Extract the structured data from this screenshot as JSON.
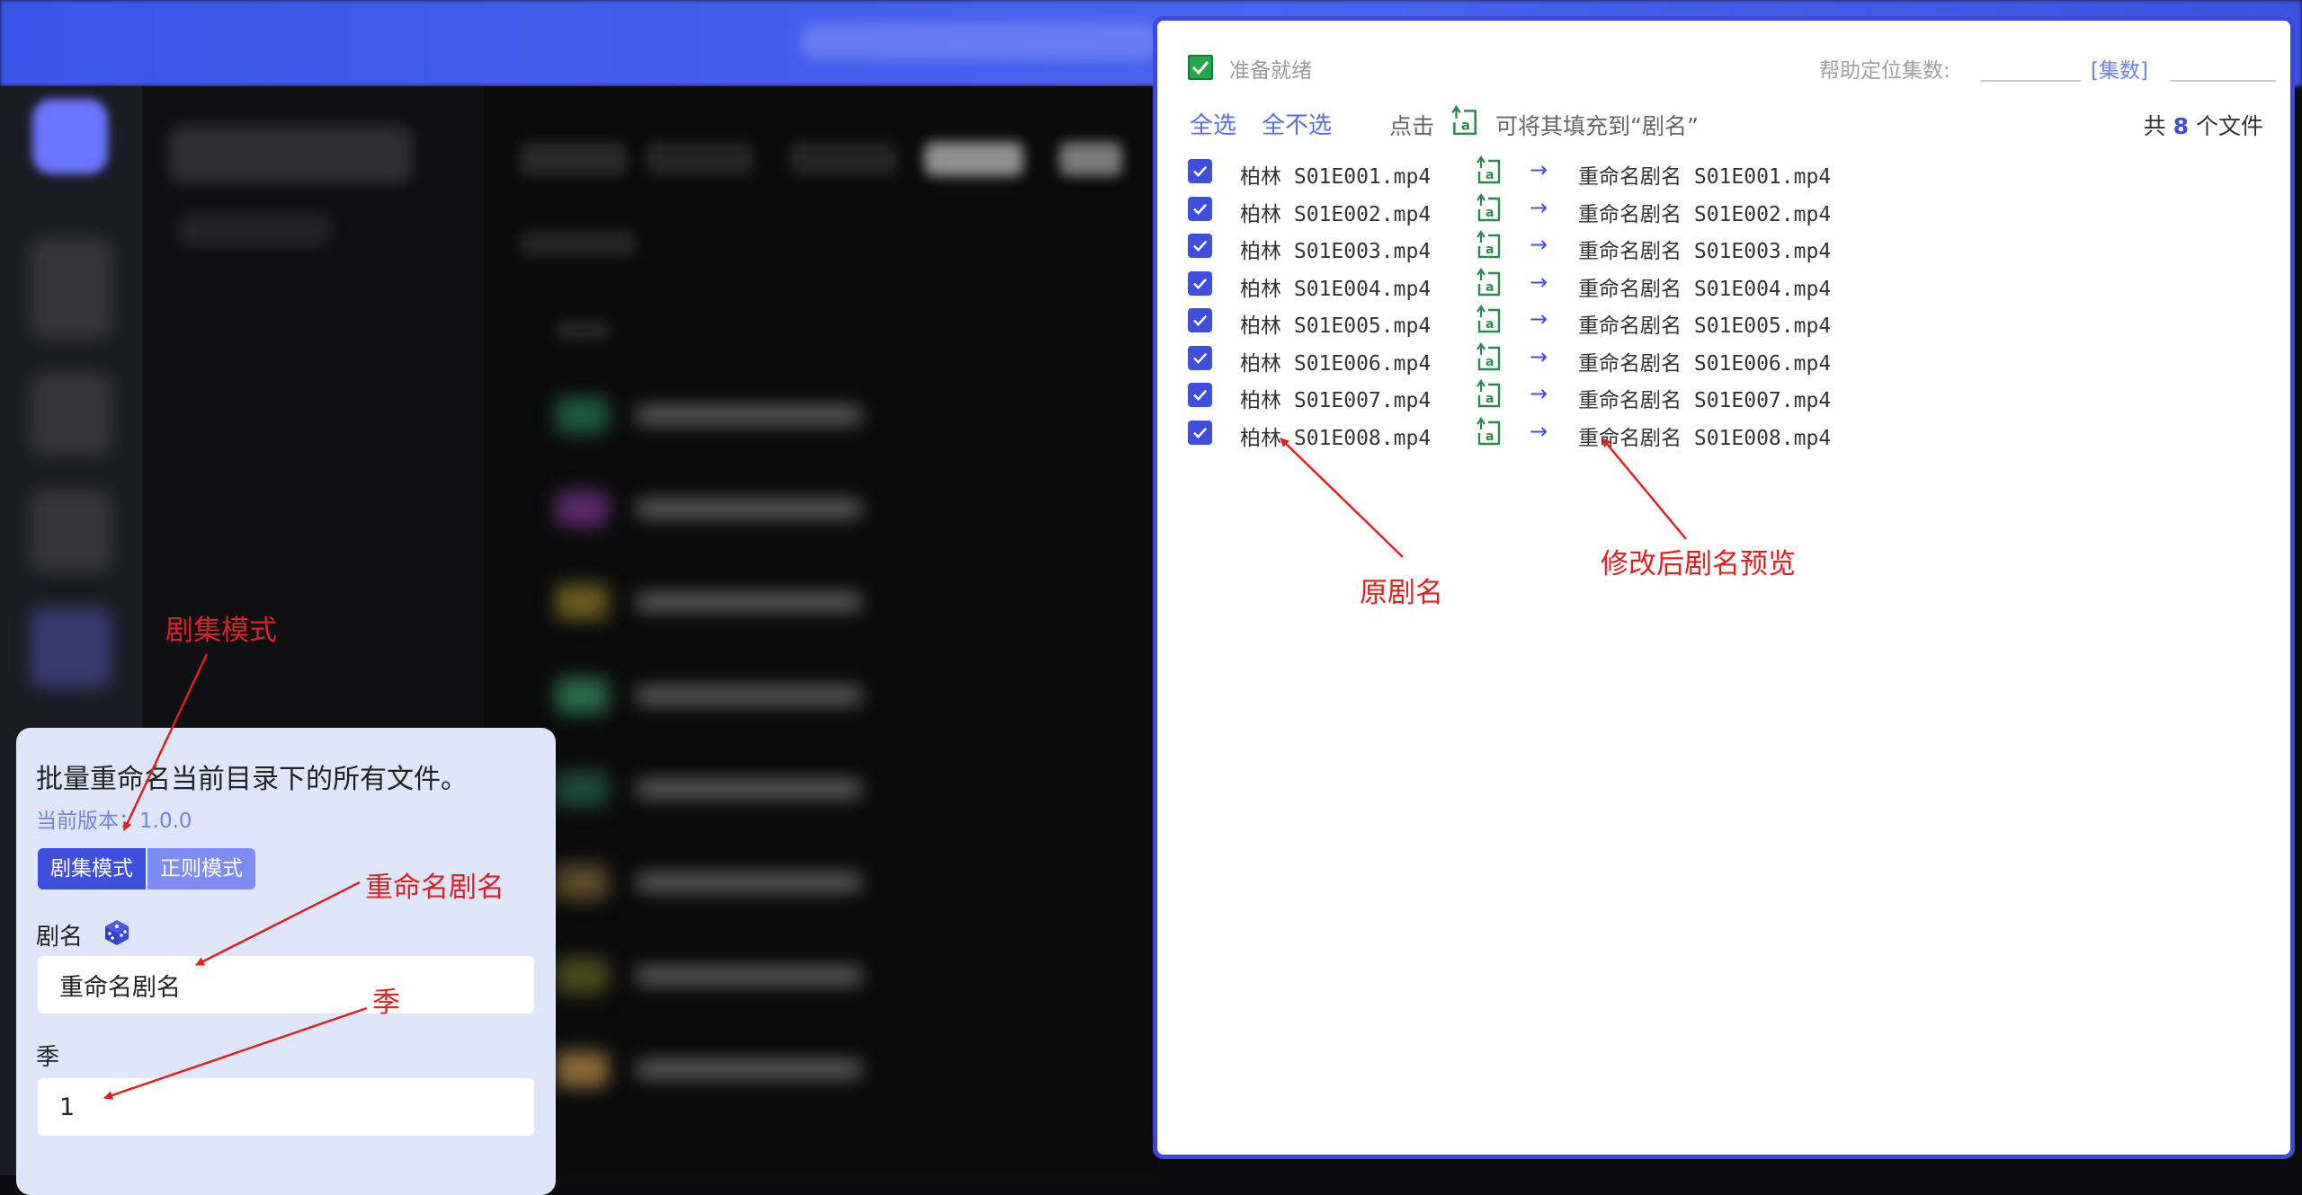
{
  "plugin": {
    "description": "批量重命名当前目录下的所有文件。",
    "version": "当前版本：1.0.0",
    "tabs": [
      {
        "label": "剧集模式",
        "active": true
      },
      {
        "label": "正则模式",
        "active": false
      }
    ],
    "show_name_label": "剧名",
    "show_name_value": "重命名剧名",
    "season_label": "季",
    "season_value": "1"
  },
  "modal": {
    "status": "准备就绪",
    "help_label": "帮助定位集数:",
    "help_tag": "[集数]",
    "select_all": "全选",
    "select_none": "全不选",
    "click_hint": "点击",
    "fill_hint": "可将其填充到“剧名”",
    "total_prefix": "共",
    "total_count": "8",
    "total_suffix": "个文件",
    "arrow_glyph": "→",
    "files": [
      {
        "original": "柏林 S01E001.mp4",
        "renamed": "重命名剧名 S01E001.mp4",
        "checked": true
      },
      {
        "original": "柏林 S01E002.mp4",
        "renamed": "重命名剧名 S01E002.mp4",
        "checked": true
      },
      {
        "original": "柏林 S01E003.mp4",
        "renamed": "重命名剧名 S01E003.mp4",
        "checked": true
      },
      {
        "original": "柏林 S01E004.mp4",
        "renamed": "重命名剧名 S01E004.mp4",
        "checked": true
      },
      {
        "original": "柏林 S01E005.mp4",
        "renamed": "重命名剧名 S01E005.mp4",
        "checked": true
      },
      {
        "original": "柏林 S01E006.mp4",
        "renamed": "重命名剧名 S01E006.mp4",
        "checked": true
      },
      {
        "original": "柏林 S01E007.mp4",
        "renamed": "重命名剧名 S01E007.mp4",
        "checked": true
      },
      {
        "original": "柏林 S01E008.mp4",
        "renamed": "重命名剧名 S01E008.mp4",
        "checked": true
      }
    ]
  },
  "annotations": {
    "original_name": "原剧名",
    "preview": "修改后剧名预览",
    "episode_mode": "剧集模式",
    "rename_show": "重命名剧名",
    "season": "季"
  },
  "colors": {
    "accent": "#3e4fe0",
    "annotation": "#e02020",
    "ready_green": "#22a84a"
  }
}
